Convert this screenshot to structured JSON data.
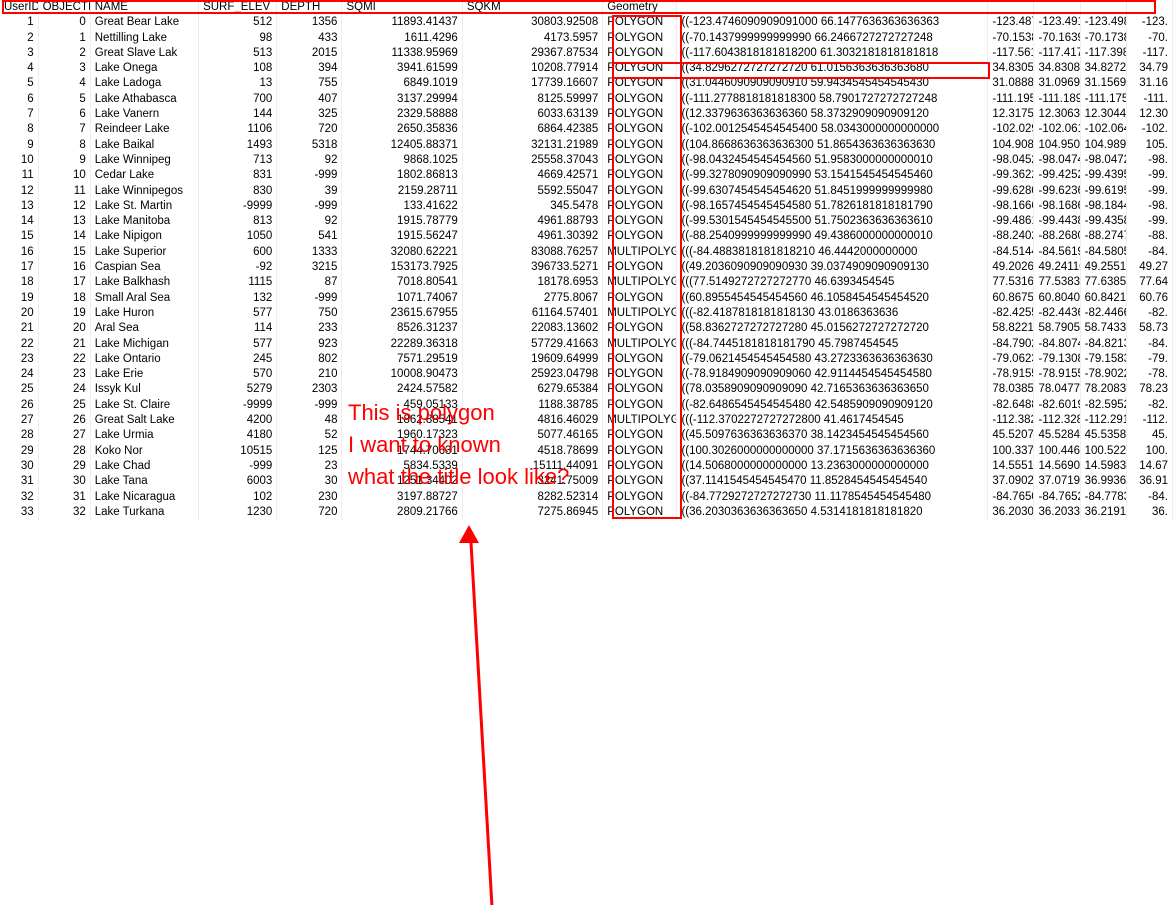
{
  "headers": {
    "userid": "UserID",
    "objectid": "OBJECTID",
    "name": "NAME",
    "surf": "SURF_ELEV",
    "depth": "DEPTH",
    "sqmi": "SQMI",
    "sqkm": "SQKM",
    "geom": "Geometry",
    "coord1": ""
  },
  "annotation": {
    "line1": "This is polygon",
    "line2": "I want to known",
    "line3": "what the title look like?"
  },
  "chart_data": {
    "type": "table",
    "rows": [
      {
        "UserID": 1,
        "OBJECTID": 0,
        "NAME": "Great Bear Lake",
        "SURF_ELEV": 512,
        "DEPTH": 1356,
        "SQMI": "11893.41437",
        "SQKM": "30803.92508",
        "Geometry": "POLYGON",
        "Coords": "((-123.4746090909091000 66.1477636363636363",
        "tail": [
          "-123.487",
          "-123.491",
          "-123.498",
          "-123."
        ]
      },
      {
        "UserID": 2,
        "OBJECTID": 1,
        "NAME": "Nettilling Lake",
        "SURF_ELEV": 98,
        "DEPTH": 433,
        "SQMI": "1611.4296",
        "SQKM": "4173.5957",
        "Geometry": "POLYGON",
        "Coords": "((-70.1437999999999990 66.2466727272727248",
        "tail": [
          "-70.1538",
          "-70.1639",
          "-70.1738",
          "-70."
        ]
      },
      {
        "UserID": 3,
        "OBJECTID": 2,
        "NAME": "Great Slave Lak",
        "SURF_ELEV": 513,
        "DEPTH": 2015,
        "SQMI": "11338.95969",
        "SQKM": "29367.87534",
        "Geometry": "POLYGON",
        "Coords": "((-117.6043818181818200 61.3032181818181818",
        "tail": [
          "-117.561",
          "-117.417",
          "-117.398",
          "-117."
        ]
      },
      {
        "UserID": 4,
        "OBJECTID": 3,
        "NAME": "Lake Onega",
        "SURF_ELEV": 108,
        "DEPTH": 394,
        "SQMI": "3941.61599",
        "SQKM": "10208.77914",
        "Geometry": "POLYGON",
        "Coords": "((34.8296272727272720 61.0156363636363680",
        "tail": [
          "34.83055",
          "34.83082",
          "34.82721",
          "34.79"
        ]
      },
      {
        "UserID": 5,
        "OBJECTID": 4,
        "NAME": "Lake Ladoga",
        "SURF_ELEV": 13,
        "DEPTH": 755,
        "SQMI": "6849.1019",
        "SQKM": "17739.16607",
        "Geometry": "POLYGON",
        "Coords": "((31.0446090909090910 59.9434545454545430",
        "tail": [
          "31.08888",
          "31.09694",
          "31.15693",
          "31.16"
        ]
      },
      {
        "UserID": 6,
        "OBJECTID": 5,
        "NAME": "Lake Athabasca",
        "SURF_ELEV": 700,
        "DEPTH": 407,
        "SQMI": "3137.29994",
        "SQKM": "8125.59997",
        "Geometry": "POLYGON",
        "Coords": "((-111.2778818181818300 58.7901727272727248",
        "tail": [
          "-111.195",
          "-111.189",
          "-111.175",
          "-111."
        ]
      },
      {
        "UserID": 7,
        "OBJECTID": 6,
        "NAME": "Lake Vanern",
        "SURF_ELEV": 144,
        "DEPTH": 325,
        "SQMI": "2329.58888",
        "SQKM": "6033.63139",
        "Geometry": "POLYGON",
        "Coords": "((12.3379636363636360 58.3732909090909120",
        "tail": [
          "12.31750",
          "12.30639",
          "12.30444",
          "12.30"
        ]
      },
      {
        "UserID": 8,
        "OBJECTID": 7,
        "NAME": "Reindeer Lake",
        "SURF_ELEV": 1106,
        "DEPTH": 720,
        "SQMI": "2650.35836",
        "SQKM": "6864.42385",
        "Geometry": "POLYGON",
        "Coords": "((-102.0012545454545400 58.0343000000000000",
        "tail": [
          "-102.029",
          "-102.061",
          "-102.064",
          "-102."
        ]
      },
      {
        "UserID": 9,
        "OBJECTID": 8,
        "NAME": "Lake Baikal",
        "SURF_ELEV": 1493,
        "DEPTH": 5318,
        "SQMI": "12405.88371",
        "SQKM": "32131.21989",
        "Geometry": "POLYGON",
        "Coords": "((104.8668636363636300 51.8654363636363630",
        "tail": [
          "104.9086",
          "104.9505",
          "104.9891",
          "105."
        ]
      },
      {
        "UserID": 10,
        "OBJECTID": 9,
        "NAME": "Lake Winnipeg",
        "SURF_ELEV": 713,
        "DEPTH": 92,
        "SQMI": "9868.1025",
        "SQKM": "25558.37043",
        "Geometry": "POLYGON",
        "Coords": "((-98.0432454545454560 51.9583000000000010",
        "tail": [
          "-98.0452",
          "-98.0474",
          "-98.0472",
          "-98."
        ]
      },
      {
        "UserID": 11,
        "OBJECTID": 10,
        "NAME": "Cedar Lake",
        "SURF_ELEV": 831,
        "DEPTH": -999,
        "SQMI": "1802.86813",
        "SQKM": "4669.42571",
        "Geometry": "POLYGON",
        "Coords": "((-99.3278090909090990 53.1541545454545460",
        "tail": [
          "-99.3622",
          "-99.4252",
          "-99.4395",
          "-99."
        ]
      },
      {
        "UserID": 12,
        "OBJECTID": 11,
        "NAME": "Lake Winnipegos",
        "SURF_ELEV": 830,
        "DEPTH": 39,
        "SQMI": "2159.28711",
        "SQKM": "5592.55047",
        "Geometry": "POLYGON",
        "Coords": "((-99.6307454545454620 51.8451999999999980",
        "tail": [
          "-99.6280",
          "-99.6236",
          "-99.6195",
          "-99."
        ]
      },
      {
        "UserID": 13,
        "OBJECTID": 12,
        "NAME": "Lake St. Martin",
        "SURF_ELEV": -9999,
        "DEPTH": -999,
        "SQMI": "133.41622",
        "SQKM": "345.5478",
        "Geometry": "POLYGON",
        "Coords": "((-98.1657454545454580 51.7826181818181790",
        "tail": [
          "-98.1666",
          "-98.1686",
          "-98.1844",
          "-98."
        ]
      },
      {
        "UserID": 14,
        "OBJECTID": 13,
        "NAME": "Lake Manitoba",
        "SURF_ELEV": 813,
        "DEPTH": 92,
        "SQMI": "1915.78779",
        "SQKM": "4961.88793",
        "Geometry": "POLYGON",
        "Coords": "((-99.5301545454545500 51.7502363636363610",
        "tail": [
          "-99.4861",
          "-99.4438",
          "-99.4358",
          "-99."
        ]
      },
      {
        "UserID": 15,
        "OBJECTID": 14,
        "NAME": "Lake Nipigon",
        "SURF_ELEV": 1050,
        "DEPTH": 541,
        "SQMI": "1915.56247",
        "SQKM": "4961.30392",
        "Geometry": "POLYGON",
        "Coords": "((-88.2540999999999990 49.4386000000000010",
        "tail": [
          "-88.2402",
          "-88.2680",
          "-88.2747",
          "-88."
        ]
      },
      {
        "UserID": 16,
        "OBJECTID": 15,
        "NAME": "Lake Superior",
        "SURF_ELEV": 600,
        "DEPTH": 1333,
        "SQMI": "32080.62221",
        "SQKM": "83088.76257",
        "Geometry": "MULTIPOLYGON",
        "Coords": "(((-84.4883818181818210 46.4442000000000",
        "tail": [
          "-84.5144",
          "-84.5619",
          "-84.5805",
          "-84."
        ]
      },
      {
        "UserID": 17,
        "OBJECTID": 16,
        "NAME": "Caspian Sea",
        "SURF_ELEV": -92,
        "DEPTH": 3215,
        "SQMI": "153173.7925",
        "SQKM": "396733.5271",
        "Geometry": "POLYGON",
        "Coords": "((49.2036090909090930 39.0374909090909130",
        "tail": [
          "49.20262",
          "49.24110",
          "49.25512",
          "49.27"
        ]
      },
      {
        "UserID": 18,
        "OBJECTID": 17,
        "NAME": "Lake Balkhash",
        "SURF_ELEV": 1115,
        "DEPTH": 87,
        "SQMI": "7018.80541",
        "SQKM": "18178.6953",
        "Geometry": "MULTIPOLYGON",
        "Coords": "(((77.5149272727272770 46.6393454545",
        "tail": [
          "77.53166",
          "77.53831",
          "77.63855",
          "77.64"
        ]
      },
      {
        "UserID": 19,
        "OBJECTID": 18,
        "NAME": "Small Aral Sea",
        "SURF_ELEV": 132,
        "DEPTH": -999,
        "SQMI": "1071.74067",
        "SQKM": "2775.8067",
        "Geometry": "POLYGON",
        "Coords": "((60.8955454545454560 46.1058454545454520",
        "tail": [
          "60.86755",
          "60.80409",
          "60.84211",
          "60.76"
        ]
      },
      {
        "UserID": 20,
        "OBJECTID": 19,
        "NAME": "Lake Huron",
        "SURF_ELEV": 577,
        "DEPTH": 750,
        "SQMI": "23615.67955",
        "SQKM": "61164.57401",
        "Geometry": "MULTIPOLYGON",
        "Coords": "(((-82.4187818181818130 43.0186363636",
        "tail": [
          "-82.4255",
          "-82.4436",
          "-82.4466",
          "-82."
        ]
      },
      {
        "UserID": 21,
        "OBJECTID": 20,
        "NAME": "Aral Sea",
        "SURF_ELEV": 114,
        "DEPTH": 233,
        "SQMI": "8526.31237",
        "SQKM": "22083.13602",
        "Geometry": "POLYGON",
        "Coords": "((58.8362727272727280 45.0156272727272720",
        "tail": [
          "58.82211",
          "58.79053",
          "58.74333",
          "58.73"
        ]
      },
      {
        "UserID": 22,
        "OBJECTID": 21,
        "NAME": "Lake Michigan",
        "SURF_ELEV": 577,
        "DEPTH": 923,
        "SQMI": "22289.36318",
        "SQKM": "57729.41663",
        "Geometry": "MULTIPOLYGON",
        "Coords": "(((-84.7445181818181790 45.7987454545",
        "tail": [
          "-84.7902",
          "-84.8074",
          "-84.8213",
          "-84."
        ]
      },
      {
        "UserID": 23,
        "OBJECTID": 22,
        "NAME": "Lake Ontario",
        "SURF_ELEV": 245,
        "DEPTH": 802,
        "SQMI": "7571.29519",
        "SQKM": "19609.64999",
        "Geometry": "POLYGON",
        "Coords": "((-79.0621454545454580 43.2723363636363630",
        "tail": [
          "-79.0623",
          "-79.1308",
          "-79.1583",
          "-79."
        ]
      },
      {
        "UserID": 24,
        "OBJECTID": 23,
        "NAME": "Lake Erie",
        "SURF_ELEV": 570,
        "DEPTH": 210,
        "SQMI": "10008.90473",
        "SQKM": "25923.04798",
        "Geometry": "POLYGON",
        "Coords": "((-78.9184909090909060 42.9114454545454580",
        "tail": [
          "-78.9155",
          "-78.9155",
          "-78.9022",
          "-78."
        ]
      },
      {
        "UserID": 25,
        "OBJECTID": 24,
        "NAME": "Issyk Kul",
        "SURF_ELEV": 5279,
        "DEPTH": 2303,
        "SQMI": "2424.57582",
        "SQKM": "6279.65384",
        "Geometry": "POLYGON",
        "Coords": "((78.0358909090909090 42.7165363636363650",
        "tail": [
          "78.03855",
          "78.04776",
          "78.20832",
          "78.23"
        ]
      },
      {
        "UserID": 26,
        "OBJECTID": 25,
        "NAME": "Lake St. Claire",
        "SURF_ELEV": -9999,
        "DEPTH": -999,
        "SQMI": "459.05133",
        "SQKM": "1188.38785",
        "Geometry": "POLYGON",
        "Coords": "((-82.6486545454545480 42.5485909090909120",
        "tail": [
          "-82.6488",
          "-82.6019",
          "-82.5952",
          "-82."
        ]
      },
      {
        "UserID": 27,
        "OBJECTID": 26,
        "NAME": "Great Salt Lake",
        "SURF_ELEV": 4200,
        "DEPTH": 48,
        "SQMI": "1862.88541",
        "SQKM": "4816.46029",
        "Geometry": "MULTIPOLYGON",
        "Coords": "(((-112.3702272727272800 41.4617454545",
        "tail": [
          "-112.382",
          "-112.328",
          "-112.291",
          "-112."
        ]
      },
      {
        "UserID": 28,
        "OBJECTID": 27,
        "NAME": "Lake Urmia",
        "SURF_ELEV": 4180,
        "DEPTH": 52,
        "SQMI": "1960.17323",
        "SQKM": "5077.46165",
        "Geometry": "POLYGON",
        "Coords": "((45.5097636363636370 38.1423454545454560",
        "tail": [
          "45.52071",
          "45.52840",
          "45.53587",
          "45."
        ]
      },
      {
        "UserID": 29,
        "OBJECTID": 28,
        "NAME": "Koko Nor",
        "SURF_ELEV": 10515,
        "DEPTH": 125,
        "SQMI": "1744.70631",
        "SQKM": "4518.78699",
        "Geometry": "POLYGON",
        "Coords": "((100.3026000000000000 37.1715636363636360",
        "tail": [
          "100.3374",
          "100.4463",
          "100.5224",
          "100."
        ]
      },
      {
        "UserID": 30,
        "OBJECTID": 29,
        "NAME": "Lake Chad",
        "SURF_ELEV": -999,
        "DEPTH": 23,
        "SQMI": "5834.5339",
        "SQKM": "15111.44091",
        "Geometry": "POLYGON",
        "Coords": "((14.5068000000000000 13.2363000000000000",
        "tail": [
          "14.55518",
          "14.56909",
          "14.59831",
          "14.67"
        ]
      },
      {
        "UserID": 31,
        "OBJECTID": 30,
        "NAME": "Lake Tana",
        "SURF_ELEV": 6003,
        "DEPTH": 30,
        "SQMI": "1251.34402",
        "SQKM": "3241.75009",
        "Geometry": "POLYGON",
        "Coords": "((37.1141545454545470 11.8528454545454540",
        "tail": [
          "37.09027",
          "37.07192",
          "36.99360",
          "36.91"
        ]
      },
      {
        "UserID": 32,
        "OBJECTID": 31,
        "NAME": "Lake Nicaragua",
        "SURF_ELEV": 102,
        "DEPTH": 230,
        "SQMI": "3197.88727",
        "SQKM": "8282.52314",
        "Geometry": "POLYGON",
        "Coords": "((-84.7729272727272730 11.1178545454545480",
        "tail": [
          "-84.7650",
          "-84.7652",
          "-84.7783",
          "-84."
        ]
      },
      {
        "UserID": 33,
        "OBJECTID": 32,
        "NAME": "Lake Turkana",
        "SURF_ELEV": 1230,
        "DEPTH": 720,
        "SQMI": "2809.21766",
        "SQKM": "7275.86945",
        "Geometry": "POLYGON",
        "Coords": "((36.2030363636363650 4.5314181818181820",
        "tail": [
          "36.20304",
          "36.20332",
          "36.21919",
          "36."
        ]
      }
    ]
  }
}
